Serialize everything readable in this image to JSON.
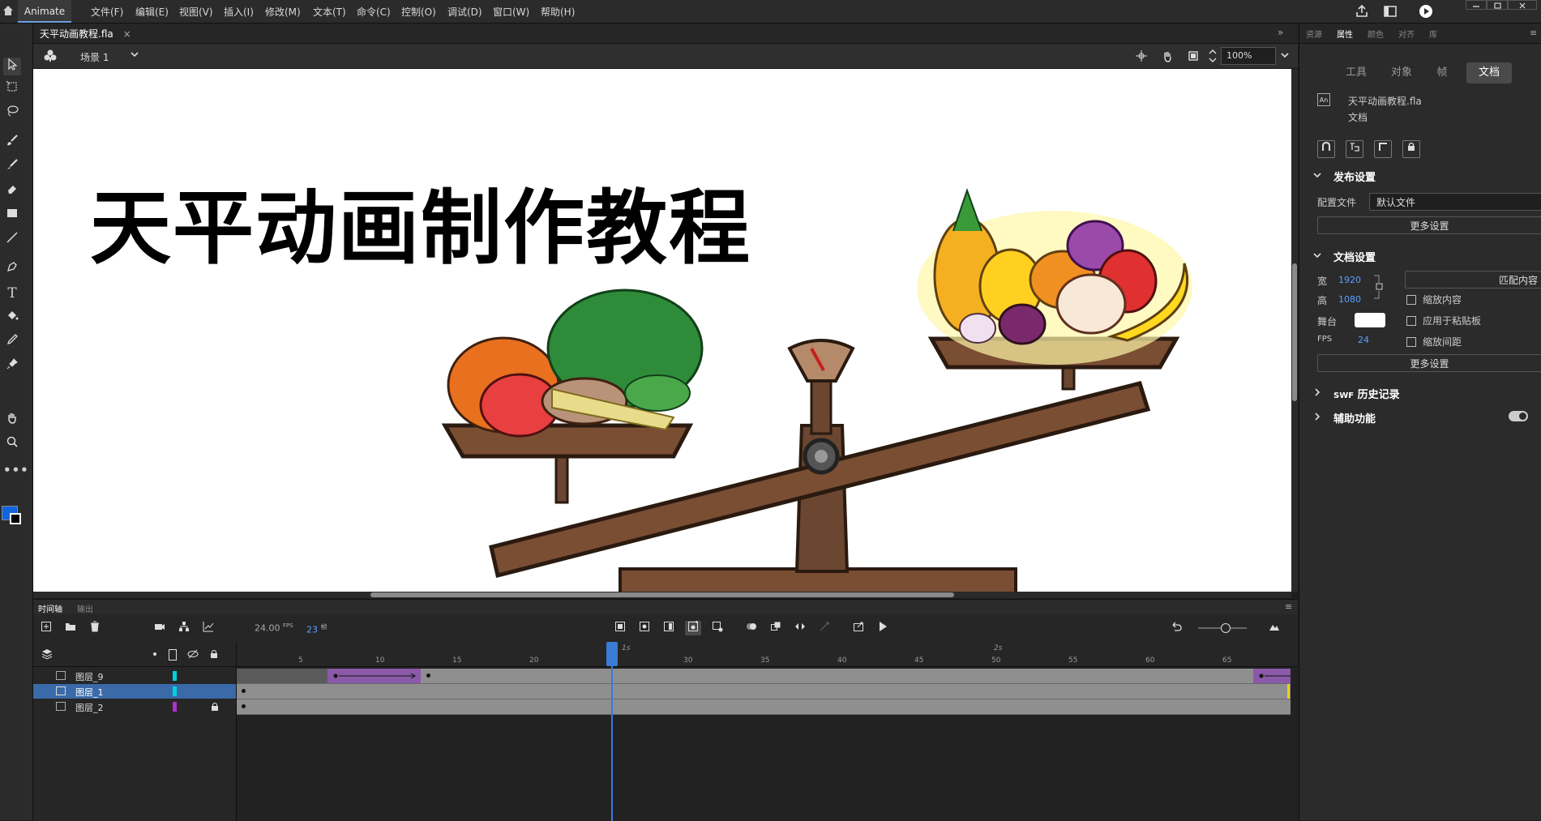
{
  "menubar": {
    "app_tab": "Animate",
    "items": [
      "文件(F)",
      "编辑(E)",
      "视图(V)",
      "插入(I)",
      "修改(M)",
      "文本(T)",
      "命令(C)",
      "控制(O)",
      "调试(D)",
      "窗口(W)",
      "帮助(H)"
    ]
  },
  "document": {
    "tab_name": "天平动画教程.fla",
    "scene": "场景 1",
    "zoom": "100%"
  },
  "stage": {
    "title": "天平动画制作教程"
  },
  "right_panel": {
    "tabs": [
      "资源",
      "属性",
      "颜色",
      "对齐",
      "库"
    ],
    "active_tab": "属性",
    "segments": [
      "工具",
      "对象",
      "帧",
      "文档"
    ],
    "active_segment": "文档",
    "doc_file": "天平动画教程.fla",
    "doc_type": "文档",
    "publish_section": "发布设置",
    "profile_label": "配置文件",
    "profile_value": "默认文件",
    "more_settings_1": "更多设置",
    "doc_settings_section": "文档设置",
    "width_label": "宽",
    "width_value": "1920",
    "height_label": "高",
    "height_value": "1080",
    "match_content": "匹配内容",
    "scale_content": "缩放内容",
    "stage_label": "舞台",
    "apply_pasteboard": "应用于粘贴板",
    "fps_label": "FPS",
    "fps_value": "24",
    "scale_spacing": "缩放间距",
    "more_settings_2": "更多设置",
    "swf_history": "历史记录",
    "swf_prefix": "SWF",
    "accessibility": "辅助功能",
    "stage_color": "#ffffff"
  },
  "timeline": {
    "tabs": [
      "时间轴",
      "输出"
    ],
    "fps": "24.00",
    "fps_unit": "FPS",
    "current_frame": "23",
    "frame_unit": "帧",
    "ruler_ticks": [
      "5",
      "10",
      "15",
      "20",
      "25",
      "30",
      "35",
      "40",
      "45",
      "50",
      "55",
      "60",
      "65"
    ],
    "ruler_seconds": [
      "1s",
      "2s"
    ],
    "layers": [
      {
        "name": "图层_9",
        "color": "#00d0e0",
        "locked": false,
        "selected": false
      },
      {
        "name": "图层_1",
        "color": "#00d0e0",
        "locked": false,
        "selected": true
      },
      {
        "name": "图层_2",
        "color": "#b030d0",
        "locked": true,
        "selected": false
      }
    ],
    "accent": "#3a7bd5"
  }
}
